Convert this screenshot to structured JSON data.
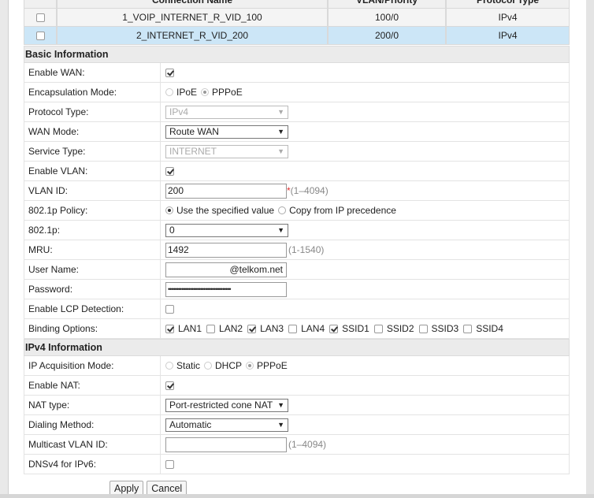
{
  "connections": {
    "headers": [
      "Connection Name",
      "VLAN/Priority",
      "Protocol Type"
    ],
    "rows": [
      {
        "name": "1_VOIP_INTERNET_R_VID_100",
        "vlan": "100/0",
        "protocol": "IPv4",
        "selected": false
      },
      {
        "name": "2_INTERNET_R_VID_200",
        "vlan": "200/0",
        "protocol": "IPv4",
        "selected": true
      }
    ]
  },
  "basic": {
    "title": "Basic Information",
    "enable_wan": {
      "label": "Enable WAN:",
      "checked": true
    },
    "encapsulation": {
      "label": "Encapsulation Mode:",
      "options": [
        "IPoE",
        "PPPoE"
      ],
      "selected": "PPPoE"
    },
    "protocol_type": {
      "label": "Protocol Type:",
      "value": "IPv4"
    },
    "wan_mode": {
      "label": "WAN Mode:",
      "value": "Route WAN"
    },
    "service_type": {
      "label": "Service Type:",
      "value": "INTERNET"
    },
    "enable_vlan": {
      "label": "Enable VLAN:",
      "checked": true
    },
    "vlan_id": {
      "label": "VLAN ID:",
      "value": "200",
      "required": "*",
      "hint": "(1–4094)"
    },
    "policy": {
      "label": "802.1p Policy:",
      "options": [
        "Use the specified value",
        "Copy from IP precedence"
      ],
      "selected": "Use the specified value"
    },
    "p8021": {
      "label": "802.1p:",
      "value": "0"
    },
    "mru": {
      "label": "MRU:",
      "value": "1492",
      "hint": "(1-1540)"
    },
    "username": {
      "label": "User Name:",
      "value": "@telkom.net"
    },
    "password": {
      "label": "Password:",
      "value": "•••••••••••••••••••••••••••••••••••••"
    },
    "lcp": {
      "label": "Enable LCP Detection:",
      "checked": false
    },
    "binding": {
      "label": "Binding Options:",
      "options": [
        {
          "name": "LAN1",
          "checked": true
        },
        {
          "name": "LAN2",
          "checked": false
        },
        {
          "name": "LAN3",
          "checked": true
        },
        {
          "name": "LAN4",
          "checked": false
        },
        {
          "name": "SSID1",
          "checked": true
        },
        {
          "name": "SSID2",
          "checked": false
        },
        {
          "name": "SSID3",
          "checked": false
        },
        {
          "name": "SSID4",
          "checked": false
        }
      ]
    }
  },
  "ipv4": {
    "title": "IPv4 Information",
    "acquisition": {
      "label": "IP Acquisition Mode:",
      "options": [
        "Static",
        "DHCP",
        "PPPoE"
      ],
      "selected": "PPPoE"
    },
    "nat": {
      "label": "Enable NAT:",
      "checked": true
    },
    "nat_type": {
      "label": "NAT type:",
      "value": "Port-restricted cone NAT"
    },
    "dialing": {
      "label": "Dialing Method:",
      "value": "Automatic"
    },
    "mvlan": {
      "label": "Multicast VLAN ID:",
      "value": "",
      "hint": "(1–4094)"
    },
    "dnsv4": {
      "label": "DNSv4 for IPv6:",
      "checked": false
    }
  },
  "buttons": {
    "apply": "Apply",
    "cancel": "Cancel"
  }
}
